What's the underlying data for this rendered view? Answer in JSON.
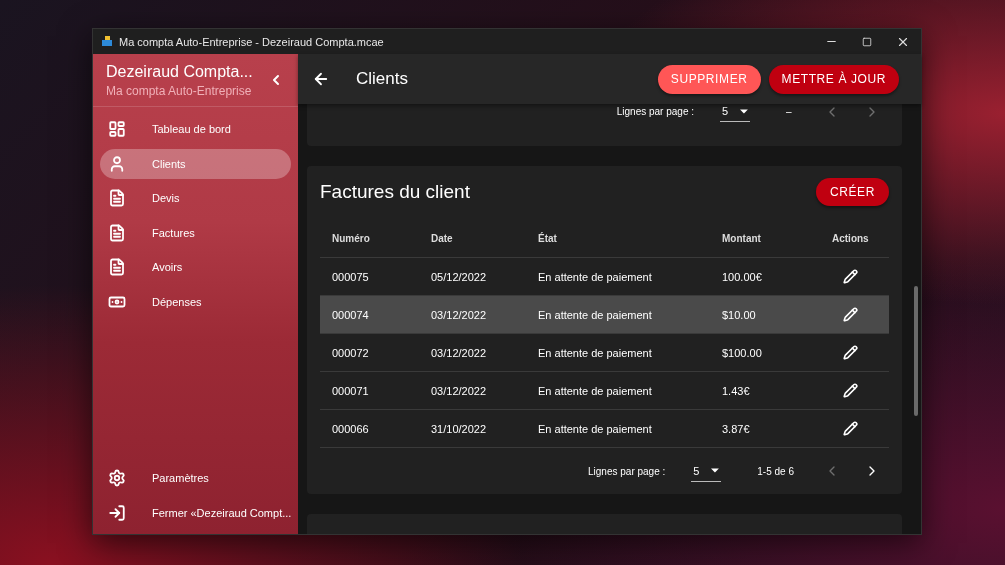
{
  "window": {
    "title": "Ma compta Auto-Entreprise - Dezeiraud Compta.mcae"
  },
  "sidebar": {
    "title": "Dezeiraud Compta...",
    "subtitle": "Ma compta Auto-Entreprise",
    "items": [
      {
        "label": "Tableau de bord",
        "selected": false
      },
      {
        "label": "Clients",
        "selected": true
      },
      {
        "label": "Devis",
        "selected": false
      },
      {
        "label": "Factures",
        "selected": false
      },
      {
        "label": "Avoirs",
        "selected": false
      },
      {
        "label": "Dépenses",
        "selected": false
      }
    ],
    "footer_items": [
      {
        "label": "Paramètres"
      },
      {
        "label": "Fermer «Dezeiraud Compt..."
      }
    ]
  },
  "header": {
    "title": "Clients",
    "buttons": [
      {
        "label": "SUPPRIMER",
        "kind": "secondary"
      },
      {
        "label": "METTRE À JOUR",
        "kind": "primary"
      }
    ]
  },
  "top_pagination": {
    "rows_label": "Lignes par page :",
    "rows_value": "5",
    "range": "–",
    "prev_disabled": true,
    "next_disabled": true
  },
  "invoices": {
    "title": "Factures du client",
    "create_button": "CRÉER",
    "columns": [
      "Numéro",
      "Date",
      "État",
      "Montant",
      "Actions"
    ],
    "rows": [
      {
        "cells": [
          "000075",
          "05/12/2022",
          "En attente de paiement",
          "100.00€"
        ],
        "selected": false
      },
      {
        "cells": [
          "000074",
          "03/12/2022",
          "En attente de paiement",
          "$10.00"
        ],
        "selected": true
      },
      {
        "cells": [
          "000072",
          "03/12/2022",
          "En attente de paiement",
          "$100.00"
        ],
        "selected": false
      },
      {
        "cells": [
          "000071",
          "03/12/2022",
          "En attente de paiement",
          "1.43€"
        ],
        "selected": false
      },
      {
        "cells": [
          "000066",
          "31/10/2022",
          "En attente de paiement",
          "3.87€"
        ],
        "selected": false
      }
    ],
    "pagination": {
      "rows_label": "Lignes par page :",
      "rows_value": "5",
      "range": "1-5 de 6",
      "prev_disabled": true,
      "next_disabled": false
    }
  }
}
